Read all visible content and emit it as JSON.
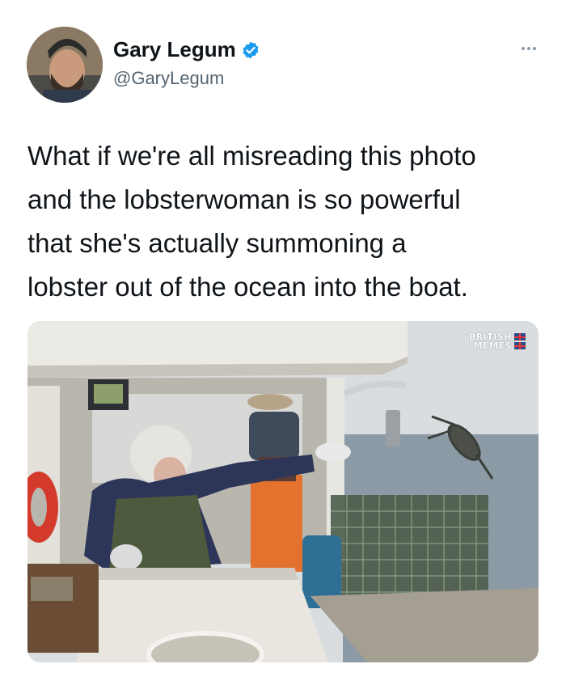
{
  "tweet": {
    "author": {
      "display_name": "Gary Legum",
      "handle": "@GaryLegum",
      "verified": true,
      "avatar_icon": "user-avatar"
    },
    "more_icon": "more-options-icon",
    "text": "What if we're all misreading this photo\nand the lobsterwoman is so powerful\nthat she's actually summoning a\nlobster out of the ocean into the boat.",
    "media": {
      "watermark_line1": "BRITISH",
      "watermark_line2": "MEMES"
    }
  },
  "colors": {
    "verified_badge": "#1d9bf0",
    "handle_text": "#536471",
    "text": "#0f1419"
  }
}
